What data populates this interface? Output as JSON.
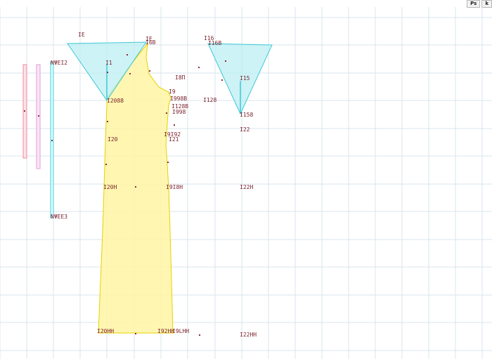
{
  "toolbar": {
    "btn_ps": "Ps",
    "btn_extra": "k"
  },
  "colors": {
    "grid": "#d9e6ec",
    "piece_yellow_fill": "#fff5a3",
    "piece_yellow_stroke": "#e6d200",
    "piece_cyan_fill": "#b8eef2",
    "piece_cyan_stroke": "#3fc7d6",
    "strip_pink": "#f08a9a",
    "strip_magenta": "#e69ad8",
    "strip_cyan": "#3fd1dc",
    "label": "#7a1f2b"
  },
  "labels": {
    "l_ie": "ΙΕ",
    "l_ie2": "ΙΕ",
    "l_i6b": "Ι6Β",
    "l_i16": "Ι16",
    "l_i16b": "Ι16Β",
    "l_i1": "Ι1",
    "l_i8": "Ι8Π",
    "l_i15": "Ι15",
    "l_i9": "Ι9",
    "l_i998b": "Ι998Β",
    "l_i128b": "Ι128Β",
    "l_i998": "Ι998",
    "l_i2088": "Ι2088",
    "l_i128": "Ι128",
    "l_i158": "Ι158",
    "l_i22": "Ι22",
    "l_i912": "Ι9Ι92",
    "l_i21": "Ι21",
    "l_i20": "Ι20",
    "l_i20h": "Ι20Η",
    "l_i9h": "Ι9Ι8Η",
    "l_i22h": "Ι22Η",
    "l_i20hh": "Ι20ΗΗ",
    "l_i92hh": "Ι92ΗΗ",
    "l_i9lhh": "Ι9LΗΗ",
    "l_i22hh": "Ι22ΗΗ",
    "strip_top": "ΝΨΕΙ2",
    "strip_bottom": "ΝΨΕΕ3"
  }
}
